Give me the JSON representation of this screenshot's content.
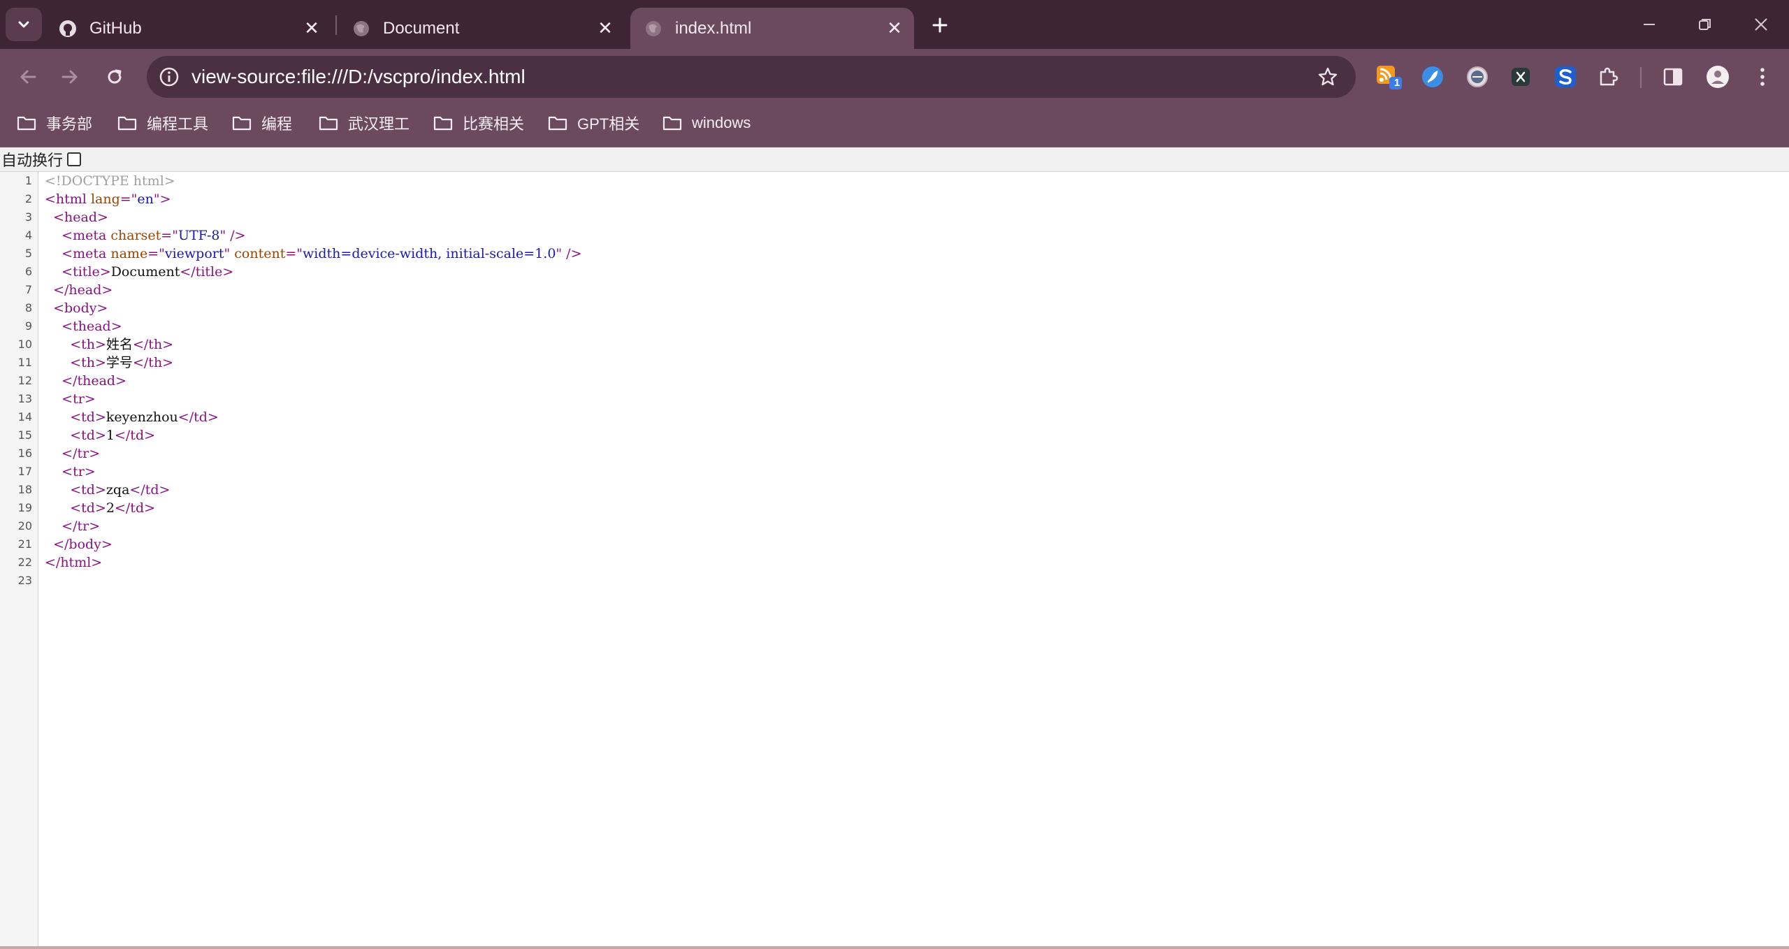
{
  "tabs": [
    {
      "title": "GitHub",
      "icon": "github-icon",
      "active": false
    },
    {
      "title": "Document",
      "icon": "globe-icon",
      "active": false
    },
    {
      "title": "index.html",
      "icon": "globe-icon",
      "active": true
    }
  ],
  "address": {
    "url": "view-source:file:///D:/vscpro/index.html"
  },
  "extensions": {
    "rss_badge": "1"
  },
  "bookmarks": [
    {
      "label": "事务部"
    },
    {
      "label": "编程工具"
    },
    {
      "label": "编程"
    },
    {
      "label": "武汉理工"
    },
    {
      "label": "比赛相关"
    },
    {
      "label": "GPT相关"
    },
    {
      "label": "windows"
    }
  ],
  "viewer": {
    "wrap_label": "自动换行",
    "wrap_checked": false
  },
  "source": {
    "line_numbers": [
      "1",
      "2",
      "3",
      "4",
      "5",
      "6",
      "7",
      "8",
      "9",
      "10",
      "11",
      "12",
      "13",
      "14",
      "15",
      "16",
      "17",
      "18",
      "19",
      "20",
      "21",
      "22",
      "23"
    ],
    "lines": [
      [
        {
          "t": "doctype",
          "v": "<!DOCTYPE html>"
        }
      ],
      [
        {
          "t": "tag",
          "v": "<html "
        },
        {
          "t": "attr",
          "v": "lang"
        },
        {
          "t": "tag",
          "v": "=\""
        },
        {
          "t": "val",
          "v": "en"
        },
        {
          "t": "tag",
          "v": "\">"
        }
      ],
      [
        {
          "t": "text",
          "v": "  "
        },
        {
          "t": "tag",
          "v": "<head>"
        }
      ],
      [
        {
          "t": "text",
          "v": "    "
        },
        {
          "t": "tag",
          "v": "<meta "
        },
        {
          "t": "attr",
          "v": "charset"
        },
        {
          "t": "tag",
          "v": "=\""
        },
        {
          "t": "val",
          "v": "UTF-8"
        },
        {
          "t": "tag",
          "v": "\" />"
        }
      ],
      [
        {
          "t": "text",
          "v": "    "
        },
        {
          "t": "tag",
          "v": "<meta "
        },
        {
          "t": "attr",
          "v": "name"
        },
        {
          "t": "tag",
          "v": "=\""
        },
        {
          "t": "val",
          "v": "viewport"
        },
        {
          "t": "tag",
          "v": "\" "
        },
        {
          "t": "attr",
          "v": "content"
        },
        {
          "t": "tag",
          "v": "=\""
        },
        {
          "t": "val",
          "v": "width=device-width, initial-scale=1.0"
        },
        {
          "t": "tag",
          "v": "\" />"
        }
      ],
      [
        {
          "t": "text",
          "v": "    "
        },
        {
          "t": "tag",
          "v": "<title>"
        },
        {
          "t": "text",
          "v": "Document"
        },
        {
          "t": "tag",
          "v": "</title>"
        }
      ],
      [
        {
          "t": "text",
          "v": "  "
        },
        {
          "t": "tag",
          "v": "</head>"
        }
      ],
      [
        {
          "t": "text",
          "v": "  "
        },
        {
          "t": "tag",
          "v": "<body>"
        }
      ],
      [
        {
          "t": "text",
          "v": "    "
        },
        {
          "t": "tag",
          "v": "<thead>"
        }
      ],
      [
        {
          "t": "text",
          "v": "      "
        },
        {
          "t": "tag",
          "v": "<th>"
        },
        {
          "t": "text",
          "v": "姓名"
        },
        {
          "t": "tag",
          "v": "</th>"
        }
      ],
      [
        {
          "t": "text",
          "v": "      "
        },
        {
          "t": "tag",
          "v": "<th>"
        },
        {
          "t": "text",
          "v": "学号"
        },
        {
          "t": "tag",
          "v": "</th>"
        }
      ],
      [
        {
          "t": "text",
          "v": "    "
        },
        {
          "t": "tag",
          "v": "</thead>"
        }
      ],
      [
        {
          "t": "text",
          "v": "    "
        },
        {
          "t": "tag",
          "v": "<tr>"
        }
      ],
      [
        {
          "t": "text",
          "v": "      "
        },
        {
          "t": "tag",
          "v": "<td>"
        },
        {
          "t": "text",
          "v": "keyenzhou"
        },
        {
          "t": "tag",
          "v": "</td>"
        }
      ],
      [
        {
          "t": "text",
          "v": "      "
        },
        {
          "t": "tag",
          "v": "<td>"
        },
        {
          "t": "text",
          "v": "1"
        },
        {
          "t": "tag",
          "v": "</td>"
        }
      ],
      [
        {
          "t": "text",
          "v": "    "
        },
        {
          "t": "tag",
          "v": "</tr>"
        }
      ],
      [
        {
          "t": "text",
          "v": "    "
        },
        {
          "t": "tag",
          "v": "<tr>"
        }
      ],
      [
        {
          "t": "text",
          "v": "      "
        },
        {
          "t": "tag",
          "v": "<td>"
        },
        {
          "t": "text",
          "v": "zqa"
        },
        {
          "t": "tag",
          "v": "</td>"
        }
      ],
      [
        {
          "t": "text",
          "v": "      "
        },
        {
          "t": "tag",
          "v": "<td>"
        },
        {
          "t": "text",
          "v": "2"
        },
        {
          "t": "tag",
          "v": "</td>"
        }
      ],
      [
        {
          "t": "text",
          "v": "    "
        },
        {
          "t": "tag",
          "v": "</tr>"
        }
      ],
      [
        {
          "t": "text",
          "v": "  "
        },
        {
          "t": "tag",
          "v": "</body>"
        }
      ],
      [
        {
          "t": "tag",
          "v": "</html>"
        }
      ],
      []
    ]
  },
  "colors": {
    "tabstrip": "#3d2535",
    "toolbar": "#6b4a60",
    "omnibox": "#4a3042",
    "tag": "#881280",
    "attribute": "#994500",
    "value": "#1a1aa6",
    "doctype": "#a0a0a0"
  }
}
